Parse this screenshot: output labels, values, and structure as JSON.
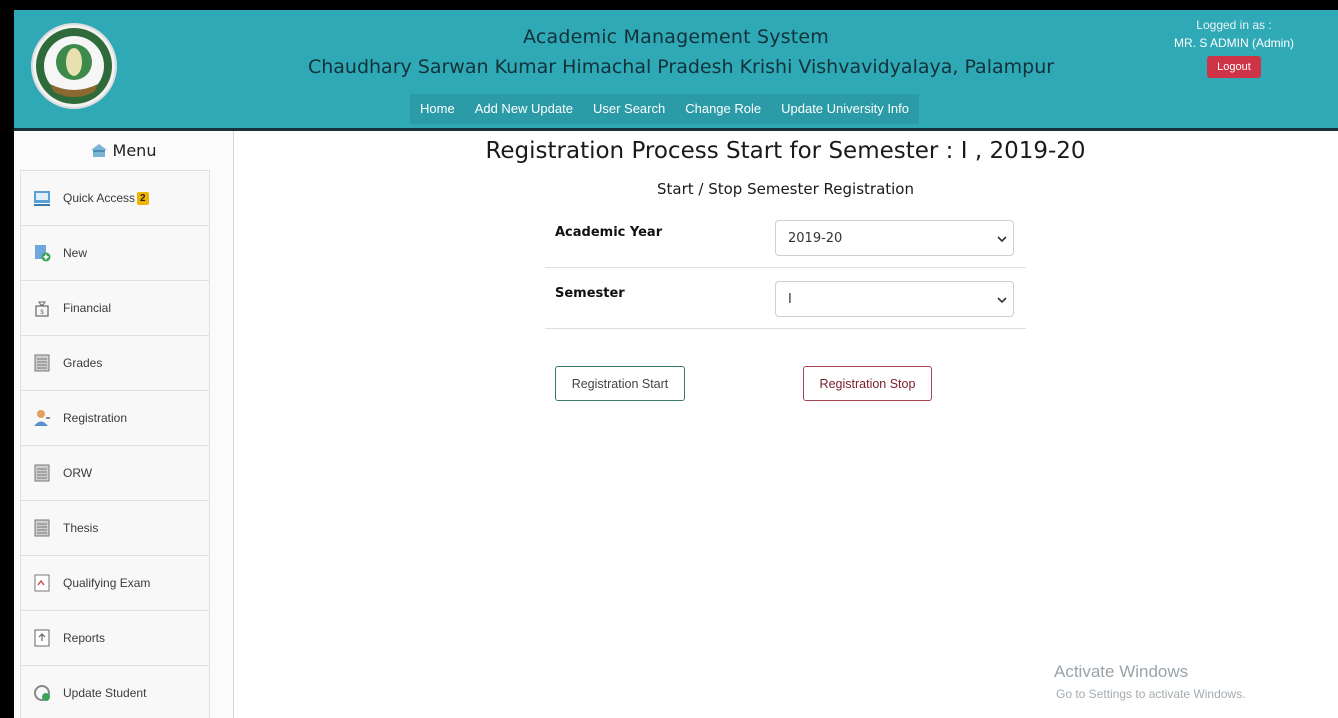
{
  "header": {
    "app_title": "Academic Management System",
    "university": "Chaudhary Sarwan Kumar Himachal Pradesh Krishi Vishvavidyalaya, Palampur",
    "nav": [
      "Home",
      "Add New Update",
      "User Search",
      "Change Role",
      "Update University Info"
    ],
    "logged_in_label": "Logged in as :",
    "user": "MR. S ADMIN (Admin)",
    "logout": "Logout",
    "colors": {
      "bar": "#2fa9b5",
      "logout": "#cf3446"
    }
  },
  "sidebar": {
    "title": "Menu",
    "items": [
      {
        "label": "Quick Access",
        "icon": "quick-access-icon",
        "badge": "2"
      },
      {
        "label": "New",
        "icon": "new-document-icon"
      },
      {
        "label": "Financial",
        "icon": "financial-bag-icon"
      },
      {
        "label": "Grades",
        "icon": "grades-sheet-icon"
      },
      {
        "label": "Registration",
        "icon": "user-registration-icon"
      },
      {
        "label": "ORW",
        "icon": "orw-sheet-icon"
      },
      {
        "label": "Thesis",
        "icon": "thesis-sheet-icon"
      },
      {
        "label": "Qualifying Exam",
        "icon": "exam-document-icon"
      },
      {
        "label": "Reports",
        "icon": "reports-icon"
      },
      {
        "label": "Update Student",
        "icon": "update-student-icon"
      }
    ]
  },
  "main": {
    "title": "Registration Process Start for Semester : I , 2019-20",
    "subtitle": "Start / Stop Semester Registration",
    "fields": {
      "academic_year": {
        "label": "Academic Year",
        "value": "2019-20"
      },
      "semester": {
        "label": "Semester",
        "value": "I"
      }
    },
    "start_button": "Registration Start",
    "stop_button": "Registration Stop"
  },
  "watermark": {
    "line1": "Activate Windows",
    "line2": "Go to Settings to activate Windows."
  }
}
